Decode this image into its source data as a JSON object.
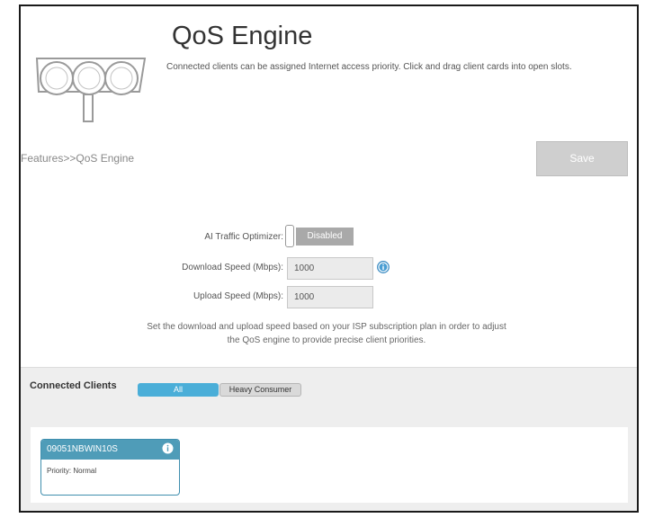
{
  "header": {
    "title": "QoS Engine",
    "description": "Connected clients can be assigned Internet access priority. Click and drag client cards into open slots."
  },
  "breadcrumb": "Features>>QoS Engine",
  "toolbar": {
    "save_label": "Save"
  },
  "form": {
    "ai_traffic_optimizer_label": "AI Traffic Optimizer:",
    "ai_traffic_optimizer_state": "Disabled",
    "download_speed_label": "Download Speed (Mbps):",
    "download_speed_value": "1000",
    "upload_speed_label": "Upload Speed (Mbps):",
    "upload_speed_value": "1000",
    "note_line1": "Set the download and upload speed based on your ISP subscription plan in order to adjust",
    "note_line2": "the QoS engine to provide precise client priorities."
  },
  "clients": {
    "title": "Connected Clients",
    "filters": [
      "All",
      "Heavy Consumer"
    ],
    "selected_filter": "All",
    "cards": [
      {
        "name": "09051NBWIN10S",
        "priority": "Priority: Normal"
      }
    ]
  },
  "colors": {
    "accent": "#4aaed8",
    "card_header": "#4f9cb8",
    "disabled_toggle": "#a9a9a9",
    "panel_bg": "#eeeeee"
  },
  "icons": [
    "traffic-light-logo",
    "info-icon"
  ]
}
